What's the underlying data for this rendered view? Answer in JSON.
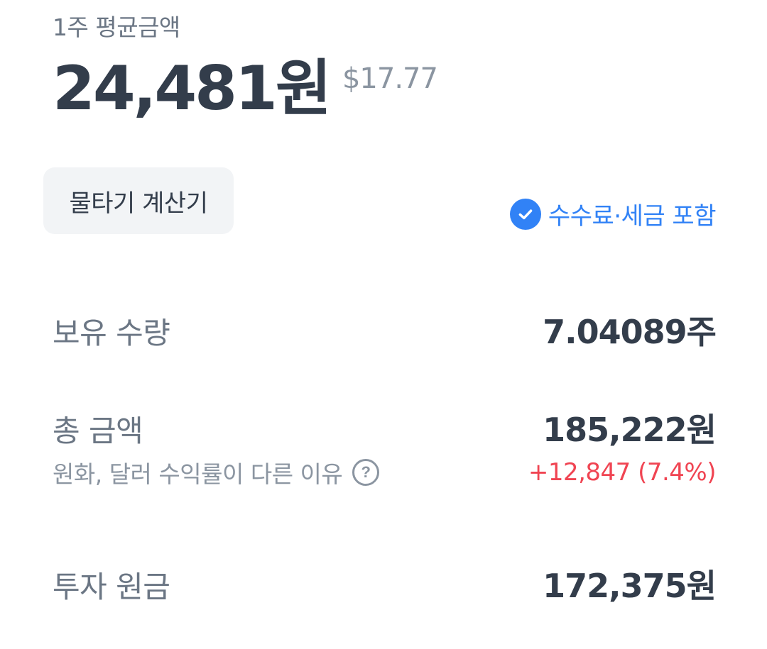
{
  "average": {
    "label": "1주 평균금액",
    "price_krw": "24,481원",
    "price_usd": "$17.77"
  },
  "calculator": {
    "button_label": "물타기 계산기"
  },
  "fee_toggle": {
    "label": "수수료·세금 포함",
    "checked": true,
    "icon": "check-circle-icon",
    "color": "#3182f6"
  },
  "holdings": {
    "label": "보유 수량",
    "value": "7.04089주"
  },
  "total": {
    "label": "총 금액",
    "value": "185,222원",
    "sub_label": "원화, 달러 수익률이 다른 이유",
    "help_icon": "question-circle-icon",
    "profit": "+12,847 (7.4%)",
    "profit_color": "#f04452"
  },
  "principal": {
    "label": "투자 원금",
    "value": "172,375원"
  }
}
